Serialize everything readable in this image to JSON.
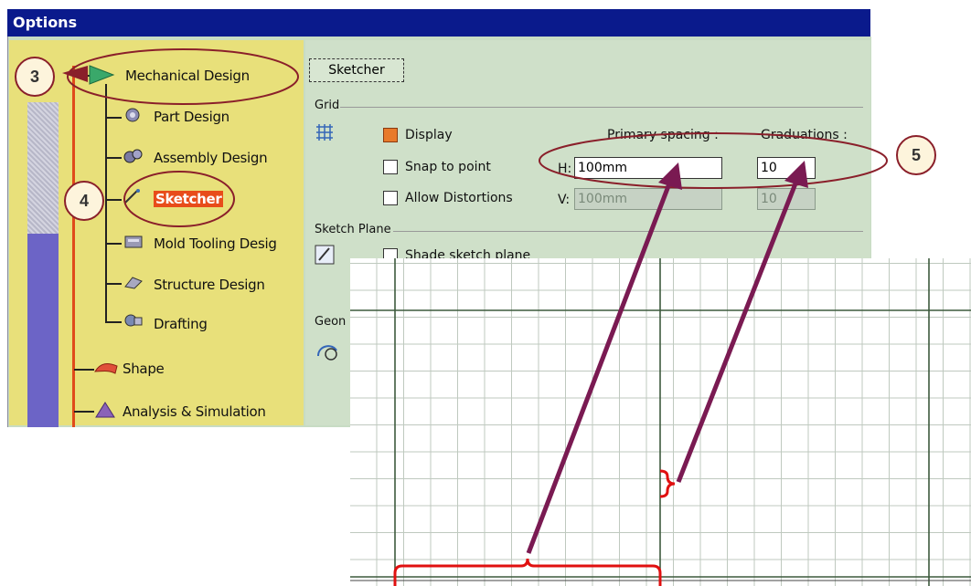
{
  "window": {
    "title": "Options"
  },
  "tree": {
    "items": [
      {
        "label": "Mechanical Design"
      },
      {
        "label": "Part Design"
      },
      {
        "label": "Assembly Design"
      },
      {
        "label": "Sketcher"
      },
      {
        "label": "Mold Tooling Desig"
      },
      {
        "label": "Structure Design"
      },
      {
        "label": "Drafting"
      },
      {
        "label": "Shape"
      },
      {
        "label": "Analysis & Simulation"
      }
    ]
  },
  "tab": {
    "label": "Sketcher"
  },
  "grid_group": {
    "title": "Grid",
    "display_label": "Display",
    "display_checked": true,
    "snap_label": "Snap to point",
    "snap_checked": false,
    "distortions_label": "Allow Distortions",
    "distortions_checked": false,
    "primary_spacing_label": "Primary spacing :",
    "graduations_label": "Graduations :",
    "h_label": "H:",
    "v_label": "V:",
    "h_spacing_value": "100mm",
    "h_graduations_value": "10",
    "v_spacing_value": "100mm",
    "v_graduations_value": "10"
  },
  "sketch_plane_group": {
    "title": "Sketch Plane",
    "shade_label": "Shade sketch plane",
    "shade_checked": false
  },
  "geometry_group": {
    "title": "Geon"
  },
  "annotations": {
    "step3": "3",
    "step4": "4",
    "step5": "5"
  },
  "colors": {
    "titlebar": "#0a1a8c",
    "tree_background": "#e8e07a",
    "annotation_outline": "#8a1f2a",
    "arrow": "#7a1a52",
    "brace": "#e01010"
  },
  "icons": {
    "mechanical_design": "green-arrow-icon",
    "part_design": "part-design-icon",
    "assembly_design": "assembly-design-icon",
    "sketcher": "sketcher-icon",
    "mold_tooling": "mold-tooling-icon",
    "structure_design": "structure-design-icon",
    "drafting": "drafting-icon",
    "shape": "shape-icon",
    "analysis": "analysis-triangle-icon",
    "grid": "grid-icon",
    "sketch_plane": "sketch-plane-icon",
    "geometry": "geometry-icon"
  }
}
